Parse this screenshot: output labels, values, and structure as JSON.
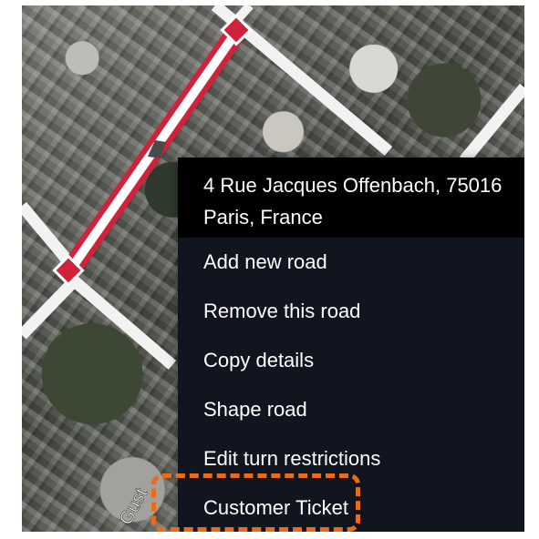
{
  "map": {
    "street_label": "Gust"
  },
  "context_menu": {
    "address": "4 Rue Jacques Offenbach, 75016 Paris, France",
    "items": [
      "Add new road",
      "Remove this road",
      "Copy details",
      "Shape road",
      "Edit turn restrictions",
      "Customer Ticket"
    ]
  },
  "colors": {
    "selected_road": "#d0233b",
    "menu_background": "#11151f",
    "menu_header_background": "#000000",
    "highlight": "#ec6b1a"
  }
}
